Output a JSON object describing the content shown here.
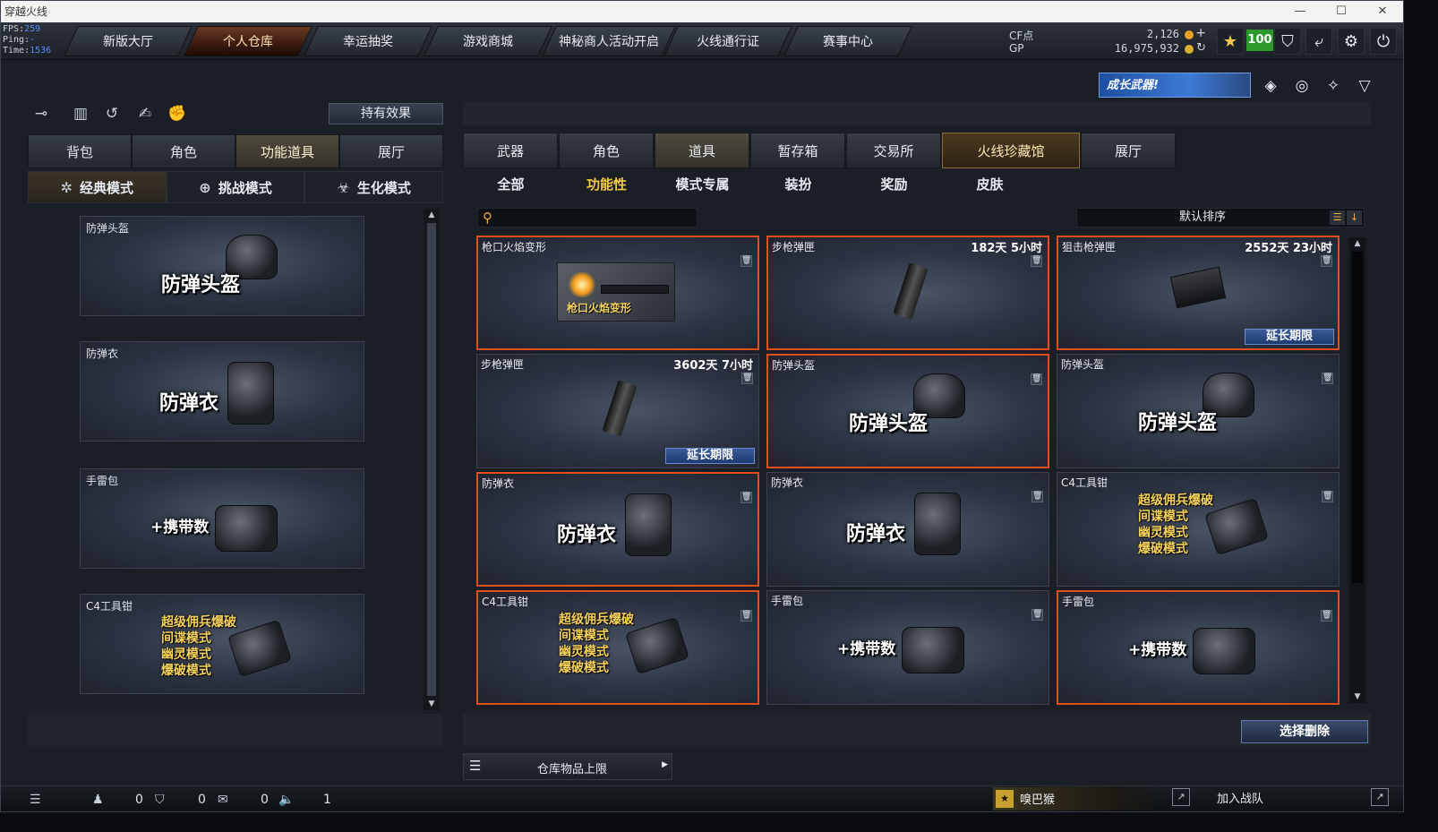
{
  "window": {
    "title": "穿越火线",
    "controls": [
      "—",
      "☐",
      "✕"
    ]
  },
  "stats": {
    "fps_label": "FPS:",
    "fps_value": "259",
    "ping_label": "Ping:",
    "ping_value": "-",
    "time_label": "Time:",
    "time_value": "1536"
  },
  "nav": {
    "tabs": [
      {
        "label": "新版大厅"
      },
      {
        "label": "个人仓库"
      },
      {
        "label": "幸运抽奖"
      },
      {
        "label": "游戏商城"
      },
      {
        "label": "神秘商人活动开启"
      },
      {
        "label": "火线通行证"
      },
      {
        "label": "赛事中心"
      }
    ],
    "active_index": 1
  },
  "currency": {
    "cf_label": "CF点",
    "cf_value": "2,126",
    "cf_plus": "+",
    "gp_label": "GP",
    "gp_value": "16,975,932",
    "gp_refresh": "↻"
  },
  "top_icons": {
    "rank_badge": "100"
  },
  "growth_banner": "成长武器!",
  "left_panel": {
    "effect_button": "持有效果",
    "tabs": [
      "背包",
      "角色",
      "功能道具",
      "展厅"
    ],
    "active_tab": 2,
    "modes": [
      {
        "label": "经典模式",
        "icon": "star-icon"
      },
      {
        "label": "挑战模式",
        "icon": "target-icon"
      },
      {
        "label": "生化模式",
        "icon": "biohazard-icon"
      }
    ],
    "items": [
      {
        "name": "防弹头盔",
        "art": "防弹头盔",
        "type": "helmet"
      },
      {
        "name": "防弹衣",
        "art": "防弹衣",
        "type": "vest"
      },
      {
        "name": "手雷包",
        "art": "+携带数",
        "type": "grenade"
      },
      {
        "name": "C4工具钳",
        "art_lines": [
          "超级佣兵爆破",
          "间谍模式",
          "幽灵模式",
          "爆破模式"
        ],
        "type": "c4"
      }
    ]
  },
  "right_panel": {
    "tabs": [
      "武器",
      "角色",
      "道具",
      "暂存箱",
      "交易所",
      "火线珍藏馆",
      "展厅"
    ],
    "active_tab": 2,
    "subtabs": [
      "全部",
      "功能性",
      "模式专属",
      "装扮",
      "奖励",
      "皮肤"
    ],
    "active_subtab": 1,
    "search_placeholder": "",
    "sort_label": "默认排序",
    "items": [
      {
        "name": "枪口火焰变形",
        "time": "",
        "art": "枪口火焰变形",
        "type": "flame",
        "selected": true
      },
      {
        "name": "步枪弹匣",
        "time": "182天 5小时",
        "type": "mag",
        "selected": true
      },
      {
        "name": "狙击枪弹匣",
        "time": "2552天 23小时",
        "type": "boxmag",
        "selected": true,
        "extend": "延长期限"
      },
      {
        "name": "步枪弹匣",
        "time": "3602天 7小时",
        "type": "mag",
        "selected": false,
        "extend": "延长期限"
      },
      {
        "name": "防弹头盔",
        "time": "",
        "art": "防弹头盔",
        "type": "helmet",
        "selected": true
      },
      {
        "name": "防弹头盔",
        "time": "",
        "art": "防弹头盔",
        "type": "helmet",
        "selected": false
      },
      {
        "name": "防弹衣",
        "time": "",
        "art": "防弹衣",
        "type": "vest",
        "selected": true
      },
      {
        "name": "防弹衣",
        "time": "",
        "art": "防弹衣",
        "type": "vest",
        "selected": false
      },
      {
        "name": "C4工具钳",
        "time": "",
        "art_lines": [
          "超级佣兵爆破",
          "间谍模式",
          "幽灵模式",
          "爆破模式"
        ],
        "type": "c4",
        "selected": false
      },
      {
        "name": "C4工具钳",
        "time": "",
        "art_lines": [
          "超级佣兵爆破",
          "间谍模式",
          "幽灵模式",
          "爆破模式"
        ],
        "type": "c4",
        "selected": true
      },
      {
        "name": "手雷包",
        "time": "",
        "art": "+携带数",
        "type": "grenade",
        "selected": false
      },
      {
        "name": "手雷包",
        "time": "",
        "art": "+携带数",
        "type": "grenade",
        "selected": true
      }
    ],
    "delete_button": "选择删除",
    "store_limit": "仓库物品上限"
  },
  "statusbar": {
    "friends_count": "0",
    "clan_count": "0",
    "chat_count": "0",
    "voice_count": "1",
    "player_name": "嗅巴猴",
    "join_team": "加入战队"
  }
}
